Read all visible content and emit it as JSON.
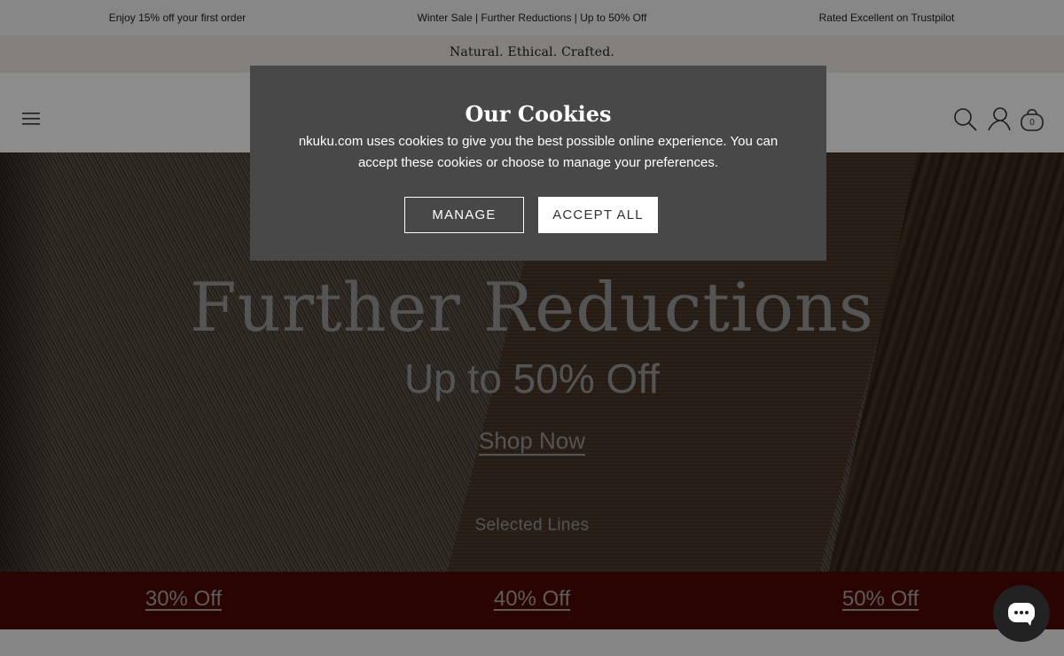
{
  "announcements": [
    "Enjoy 15% off your first order",
    "Winter Sale | Further Reductions | Up to 50% Off",
    "Rated Excellent on Trustpilot"
  ],
  "tagline": "Natural. Ethical. Crafted.",
  "header": {
    "menu_icon": "hamburger-menu-icon",
    "icons": [
      "search-icon",
      "account-icon",
      "basket-icon"
    ],
    "basket_count": "0"
  },
  "hero": {
    "title": "Further Reductions",
    "subtitle": "Up to 50% Off",
    "cta": "Shop Now",
    "note": "Selected Lines"
  },
  "offers": [
    "30% Off",
    "40% Off",
    "50% Off"
  ],
  "cookie_modal": {
    "title": "Our Cookies",
    "text": "nkuku.com uses cookies to give you the best possible online experience. You can accept these cookies or choose to manage your preferences.",
    "manage_label": "MANAGE",
    "accept_label": "ACCEPT ALL"
  },
  "chat": {
    "icon": "chat-icon"
  },
  "colors": {
    "offer_bar": "#4e0800",
    "modal_bg": "#484849",
    "tagline_bg": "#f1ece4"
  }
}
